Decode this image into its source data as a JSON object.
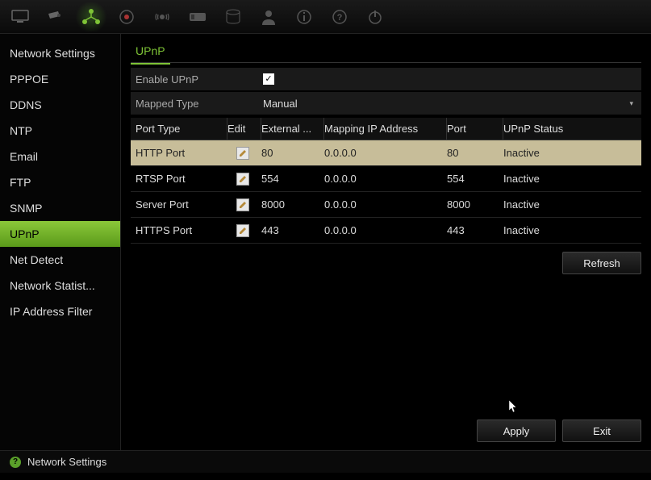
{
  "topbar": {
    "icons": [
      "monitor",
      "camera",
      "network",
      "record",
      "alarm",
      "vca",
      "hdd",
      "user",
      "info",
      "help",
      "power"
    ]
  },
  "sidebar": {
    "items": [
      {
        "label": "Network Settings"
      },
      {
        "label": "PPPOE"
      },
      {
        "label": "DDNS"
      },
      {
        "label": "NTP"
      },
      {
        "label": "Email"
      },
      {
        "label": "FTP"
      },
      {
        "label": "SNMP"
      },
      {
        "label": "UPnP"
      },
      {
        "label": "Net Detect"
      },
      {
        "label": "Network Statist..."
      },
      {
        "label": "IP Address Filter"
      }
    ],
    "active_index": 7
  },
  "tab": {
    "title": "UPnP"
  },
  "form": {
    "enable_label": "Enable UPnP",
    "enable_checked": true,
    "mapped_type_label": "Mapped Type",
    "mapped_type_value": "Manual"
  },
  "table": {
    "headers": {
      "port_type": "Port Type",
      "edit": "Edit",
      "external": "External ...",
      "mapping": "Mapping IP Address",
      "port": "Port",
      "status": "UPnP Status"
    },
    "rows": [
      {
        "port_type": "HTTP Port",
        "external": "80",
        "mapping": "0.0.0.0",
        "port": "80",
        "status": "Inactive"
      },
      {
        "port_type": "RTSP Port",
        "external": "554",
        "mapping": "0.0.0.0",
        "port": "554",
        "status": "Inactive"
      },
      {
        "port_type": "Server Port",
        "external": "8000",
        "mapping": "0.0.0.0",
        "port": "8000",
        "status": "Inactive"
      },
      {
        "port_type": "HTTPS Port",
        "external": "443",
        "mapping": "0.0.0.0",
        "port": "443",
        "status": "Inactive"
      }
    ],
    "selected_index": 0
  },
  "buttons": {
    "refresh": "Refresh",
    "apply": "Apply",
    "exit": "Exit"
  },
  "statusbar": {
    "title": "Network Settings"
  }
}
